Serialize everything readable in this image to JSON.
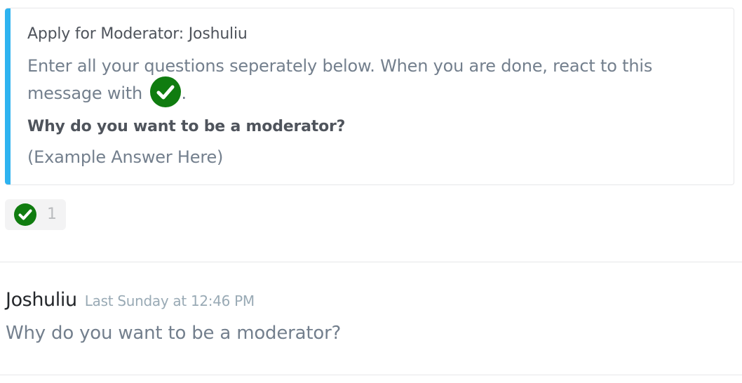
{
  "colors": {
    "embed_accent": "#2eb3f0",
    "check_green": "#107c10"
  },
  "embed": {
    "title": "Apply for Moderator: Joshuliu",
    "description_text": "Enter all your questions seperately below. When you are done, react to this message with",
    "description_suffix": ".",
    "inline_emoji_icon": "white-check-mark-icon",
    "field_name": "Why do you want to be a moderator?",
    "field_value": "(Example Answer Here)"
  },
  "reaction": {
    "emoji_icon": "white-check-mark-icon",
    "count": "1"
  },
  "message": {
    "username": "Joshuliu",
    "timestamp": "Last Sunday at 12:46 PM",
    "content": "Why do you want to be a moderator?"
  }
}
